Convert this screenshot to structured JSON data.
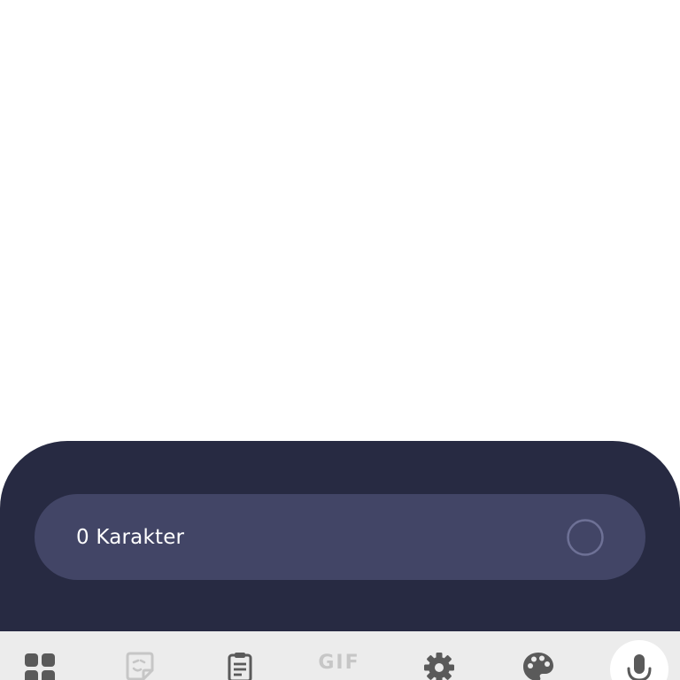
{
  "composer": {
    "char_count_label": "0 Karakter",
    "char_count_progress": 0
  },
  "toolbar": {
    "items": [
      {
        "name": "apps-grid",
        "icon": "grid-icon"
      },
      {
        "name": "stickers",
        "icon": "sticker-icon"
      },
      {
        "name": "clipboard",
        "icon": "clipboard-icon"
      },
      {
        "name": "gif",
        "label": "GIF",
        "icon": "gif-icon"
      },
      {
        "name": "settings",
        "icon": "gear-icon"
      },
      {
        "name": "themes",
        "icon": "palette-icon"
      },
      {
        "name": "voice-input",
        "icon": "mic-icon"
      }
    ]
  },
  "colors": {
    "panel_bg": "#272a42",
    "pill_bg": "#424566",
    "toolbar_bg": "#ececec",
    "icon_dark": "#5a5a5a",
    "icon_light": "#c6c6c6"
  }
}
